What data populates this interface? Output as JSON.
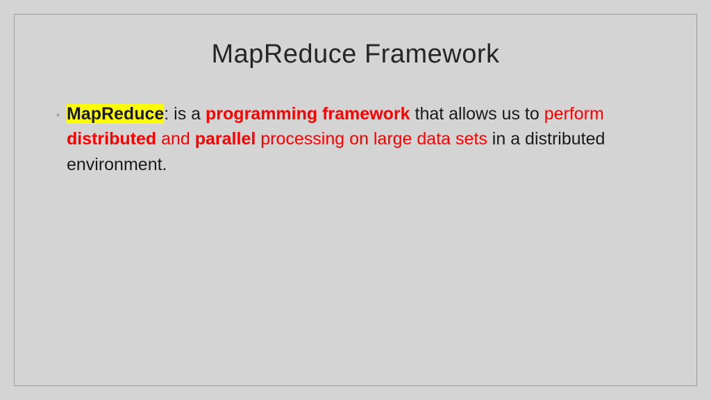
{
  "title": "MapReduce Framework",
  "content": {
    "term": "MapReduce",
    "seg1": ": is a ",
    "seg2": "programming framework",
    "seg3": " that allows us to ",
    "seg4": "perform ",
    "seg5": "distributed",
    "seg6": " and ",
    "seg7": "parallel",
    "seg8": " processing on large data sets",
    "seg9": " in a distributed environment."
  }
}
